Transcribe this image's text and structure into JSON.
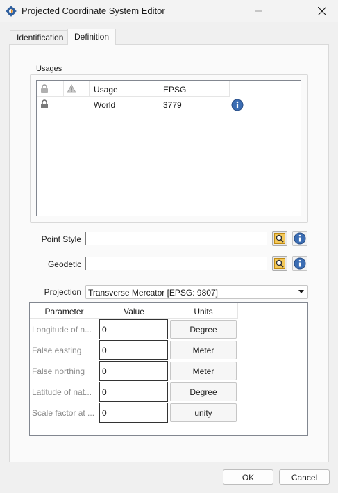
{
  "window": {
    "title": "Projected Coordinate System Editor",
    "icon": "app-gear-icon"
  },
  "tabs": [
    {
      "label": "Identification",
      "active": false
    },
    {
      "label": "Definition",
      "active": true
    }
  ],
  "usages": {
    "group_label": "Usages",
    "columns": [
      "Usage",
      "EPSG"
    ],
    "rows": [
      {
        "usage": "World",
        "epsg": "3779"
      }
    ]
  },
  "fields": {
    "point_style_label": "Point Style",
    "point_style_value": "",
    "geodetic_label": "Geodetic",
    "geodetic_value": ""
  },
  "projection": {
    "label": "Projection",
    "value": "Transverse Mercator [EPSG: 9807]"
  },
  "parameters": {
    "headers": [
      "Parameter",
      "Value",
      "Units"
    ],
    "rows": [
      {
        "name": "Longitude of n...",
        "value": "0",
        "unit": "Degree"
      },
      {
        "name": "False easting",
        "value": "0",
        "unit": "Meter"
      },
      {
        "name": "False northing",
        "value": "0",
        "unit": "Meter"
      },
      {
        "name": "Latitude of nat...",
        "value": "0",
        "unit": "Degree"
      },
      {
        "name": "Scale factor at ...",
        "value": "0",
        "unit": "unity"
      }
    ]
  },
  "buttons": {
    "ok": "OK",
    "cancel": "Cancel"
  },
  "colors": {
    "info_blue": "#3b6db3",
    "tool_orange": "#f0a020"
  }
}
